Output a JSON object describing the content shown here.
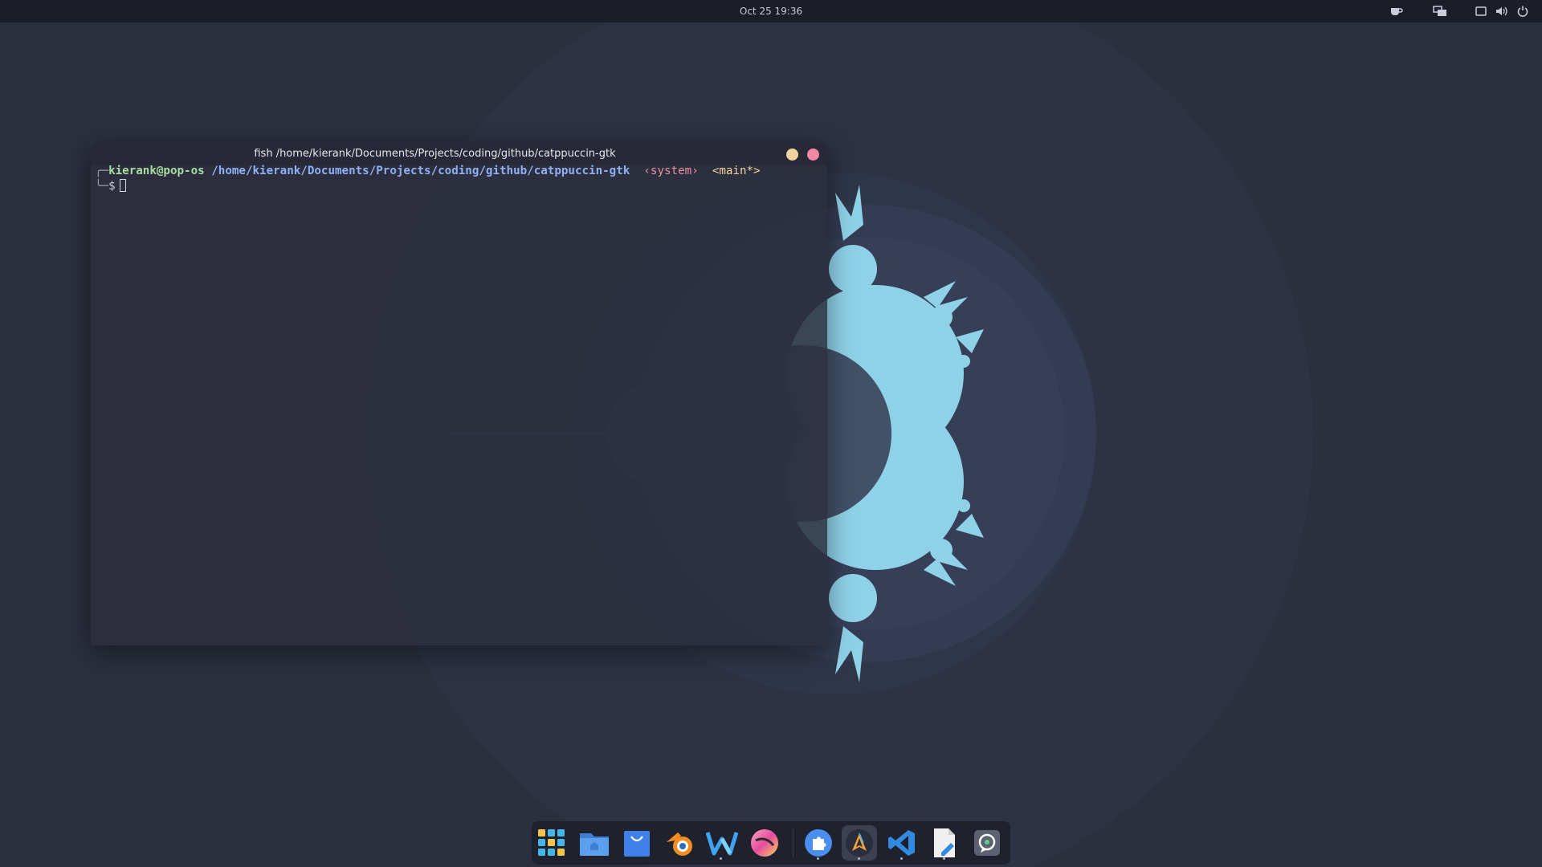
{
  "topbar": {
    "clock": "Oct 25  19:36",
    "tray_icons": [
      "coffee-icon",
      "display-switch-icon",
      "window-icon",
      "volume-icon",
      "power-icon"
    ]
  },
  "terminal": {
    "title": "fish /home/kierank/Documents/Projects/coding/github/catppuccin-gtk",
    "prompt": {
      "branch_top": "╭─",
      "user_host": "kierank@pop-os",
      "path": "/home/kierank/Documents/Projects/coding/github/catppuccin-gtk",
      "env": "‹system›",
      "git": "<main*>",
      "branch_bottom": "╰─",
      "symbol": "$"
    },
    "buttons": [
      "minimize",
      "close"
    ]
  },
  "dock": {
    "items": [
      {
        "name": "app-grid-icon",
        "running": false
      },
      {
        "name": "files-icon",
        "running": false
      },
      {
        "name": "shop-icon",
        "running": false
      },
      {
        "name": "blender-icon",
        "running": false
      },
      {
        "name": "wps-writer-icon",
        "running": true
      },
      {
        "name": "color-picker-icon",
        "running": false
      },
      {
        "name": "extensions-icon",
        "running": true
      },
      {
        "name": "arch-terminal-icon",
        "running": true,
        "active": true
      },
      {
        "name": "vscode-icon",
        "running": true
      },
      {
        "name": "text-editor-icon",
        "running": true
      },
      {
        "name": "chat-icon",
        "running": false
      }
    ]
  },
  "colors": {
    "wallpaper_base": "#2b303e",
    "fractal": "#8fd2e8",
    "topbar": "#1b1e28",
    "terminal_bg": "#2c2f3e",
    "close": "#f08aa2",
    "minimize": "#f0d39f"
  }
}
